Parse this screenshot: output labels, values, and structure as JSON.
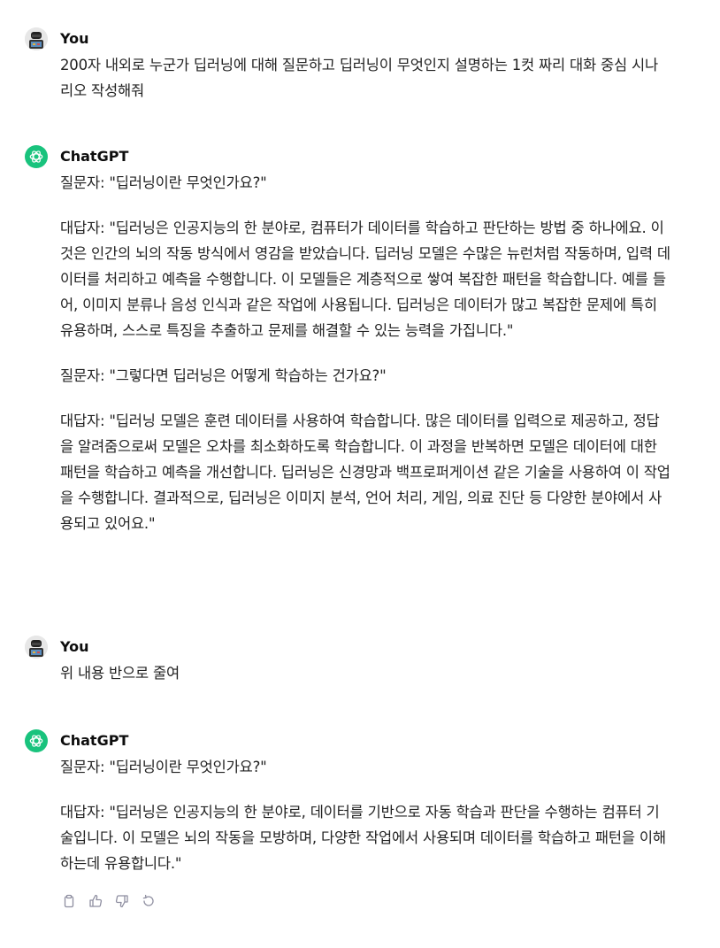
{
  "conversation": [
    {
      "author": "You",
      "paragraphs": [
        "200자 내외로 누군가 딥러닝에 대해 질문하고 딥러닝이 무엇인지 설명하는 1컷 짜리 대화 중심 시나리오 작성해줘"
      ]
    },
    {
      "author": "ChatGPT",
      "paragraphs": [
        "질문자: \"딥러닝이란 무엇인가요?\"",
        "대답자: \"딥러닝은 인공지능의 한 분야로, 컴퓨터가 데이터를 학습하고 판단하는 방법 중 하나에요. 이것은 인간의 뇌의 작동 방식에서 영감을 받았습니다. 딥러닝 모델은 수많은 뉴런처럼 작동하며, 입력 데이터를 처리하고 예측을 수행합니다. 이 모델들은 계층적으로 쌓여 복잡한 패턴을 학습합니다. 예를 들어, 이미지 분류나 음성 인식과 같은 작업에 사용됩니다. 딥러닝은 데이터가 많고 복잡한 문제에 특히 유용하며, 스스로 특징을 추출하고 문제를 해결할 수 있는 능력을 가집니다.\"",
        "질문자: \"그렇다면 딥러닝은 어떻게 학습하는 건가요?\"",
        "대답자: \"딥러닝 모델은 훈련 데이터를 사용하여 학습합니다. 많은 데이터를 입력으로 제공하고, 정답을 알려줌으로써 모델은 오차를 최소화하도록 학습합니다. 이 과정을 반복하면 모델은 데이터에 대한 패턴을 학습하고 예측을 개선합니다. 딥러닝은 신경망과 백프로퍼게이션 같은 기술을 사용하여 이 작업을 수행합니다. 결과적으로, 딥러닝은 이미지 분석, 언어 처리, 게임, 의료 진단 등 다양한 분야에서 사용되고 있어요.\""
      ]
    },
    {
      "author": "You",
      "paragraphs": [
        "위 내용 반으로 줄여"
      ]
    },
    {
      "author": "ChatGPT",
      "paragraphs": [
        "질문자: \"딥러닝이란 무엇인가요?\"",
        "대답자: \"딥러닝은 인공지능의 한 분야로, 데이터를 기반으로 자동 학습과 판단을 수행하는 컴퓨터 기술입니다. 이 모델은 뇌의 작동을 모방하며, 다양한 작업에서 사용되며 데이터를 학습하고 패턴을 이해하는데 유용합니다.\""
      ]
    }
  ],
  "actions": {
    "icons": [
      "clipboard-icon",
      "thumbs-up-icon",
      "thumbs-down-icon",
      "regenerate-icon"
    ]
  },
  "colors": {
    "bot_avatar": "#19c37d",
    "text": "#0d0d0d",
    "icon": "#8e8ea0"
  }
}
